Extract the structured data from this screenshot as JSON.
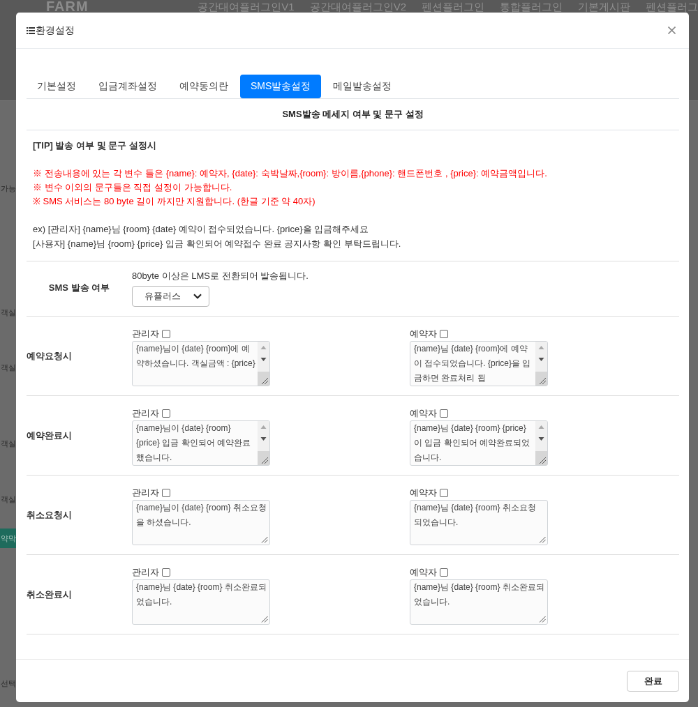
{
  "background_page": {
    "logo": "FARM",
    "nav": [
      "공간대여플러그인V1",
      "공간대여플러그인V2",
      "펜션플러그인",
      "통합플러그인",
      "기본게시판",
      "펜션플러그"
    ],
    "side_items": [
      {
        "text": "가능",
        "kind": "text"
      },
      {
        "text": "객실",
        "kind": "text"
      },
      {
        "text": "객실",
        "kind": "text"
      },
      {
        "text": "객실",
        "kind": "text"
      },
      {
        "text": "객실",
        "kind": "text"
      },
      {
        "text": "약막",
        "kind": "button"
      },
      {
        "text": "선택",
        "kind": "text"
      }
    ]
  },
  "dialog": {
    "title": "환경설정",
    "tabs": [
      {
        "label": "기본설정",
        "selected": false
      },
      {
        "label": "입금계좌설정",
        "selected": false
      },
      {
        "label": "예약동의란",
        "selected": false
      },
      {
        "label": "SMS발송설정",
        "selected": true
      },
      {
        "label": "메일발송설정",
        "selected": false
      }
    ],
    "section_title": "SMS발송 메세지 여부 및 문구 설정",
    "tip": {
      "title": "[TIP] 발송 여부 및 문구 설정시",
      "notes": [
        "※ 전송내용에 있는 각 변수 들은 {name}: 예약자, {date}: 숙박날짜,{room}: 방이름,{phone}: 핸드폰번호 , {price}: 예약금액입니다.",
        "※ 변수 이외의 문구들은 직접 설정이 가능합니다.",
        "※ SMS 서비스는 80 byte 길이 까지만 지원합니다. (한글 기준 약 40자)"
      ],
      "examples": [
        "ex) [관리자] {name}님 {room} {date} 예약이 접수되었습니다. {price}을 입금해주세요",
        "[사용자] {name}님 {room} {price} 입금 확인되어 예약접수 완료 공지사항 확인 부탁드립니다."
      ]
    },
    "sms_setting": {
      "label": "SMS 발송 여부",
      "hint": "80byte 이상은 LMS로 전환되어 발송됩니다.",
      "provider": "유플러스"
    },
    "message_rows": [
      {
        "label": "예약요청시",
        "messages": [
          {
            "recipient": "관리자",
            "checked": false,
            "text": "{name}님이 {date} {room}에 예약하셨습니다. 객실금액 : {price}",
            "scrollbar": true
          },
          {
            "recipient": "예약자",
            "checked": false,
            "text": "{name}님 {date} {room}에 예약이 접수되었습니다. {price}을 입금하면 완료처리 됩",
            "scrollbar": true
          }
        ]
      },
      {
        "label": "예약완료시",
        "messages": [
          {
            "recipient": "관리자",
            "checked": false,
            "text": "{name}님이 {date} {room} {price} 입금 확인되어 예약완료했습니다.",
            "scrollbar": true
          },
          {
            "recipient": "예약자",
            "checked": false,
            "text": "{name}님 {date} {room} {price}이 입금 확인되어 예약완료되었습니다.",
            "scrollbar": true
          }
        ]
      },
      {
        "label": "취소요청시",
        "messages": [
          {
            "recipient": "관리자",
            "checked": false,
            "text": "{name}님이 {date} {room} 취소요청을 하셨습니다.",
            "scrollbar": false
          },
          {
            "recipient": "예약자",
            "checked": false,
            "text": "{name}님 {date} {room} 취소요청 되었습니다.",
            "scrollbar": false
          }
        ]
      },
      {
        "label": "취소완료시",
        "messages": [
          {
            "recipient": "관리자",
            "checked": false,
            "text": "{name}님 {date} {room} 취소완료되었습니다.",
            "scrollbar": false
          },
          {
            "recipient": "예약자",
            "checked": false,
            "text": "{name}님 {date} {room} 취소완료되었습니다.",
            "scrollbar": false
          }
        ]
      }
    ],
    "buttons": [
      "완료"
    ]
  }
}
